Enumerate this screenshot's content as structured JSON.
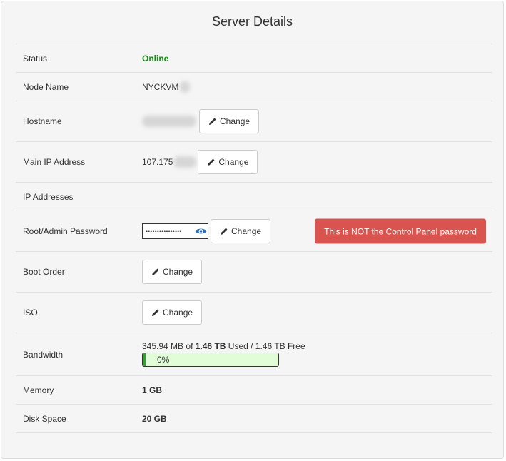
{
  "panel": {
    "title": "Server Details"
  },
  "rows": {
    "status": {
      "label": "Status",
      "value": "Online"
    },
    "node": {
      "label": "Node Name",
      "value": "NYCKVM"
    },
    "hostname": {
      "label": "Hostname",
      "button": "Change"
    },
    "main_ip": {
      "label": "Main IP Address",
      "value": "107.175",
      "button": "Change"
    },
    "ip_addresses": {
      "label": "IP Addresses"
    },
    "password": {
      "label": "Root/Admin Password",
      "masked": "••••••••••••••••",
      "button": "Change",
      "alert": "This is NOT the Control Panel password"
    },
    "boot_order": {
      "label": "Boot Order",
      "button": "Change"
    },
    "iso": {
      "label": "ISO",
      "button": "Change"
    },
    "bandwidth": {
      "label": "Bandwidth",
      "used": "345.94 MB",
      "of": "of",
      "total": "1.46 TB",
      "suffix": "Used / 1.46 TB Free",
      "percent_label": "0%",
      "percent": 0.02
    },
    "memory": {
      "label": "Memory",
      "value": "1 GB"
    },
    "disk": {
      "label": "Disk Space",
      "value": "20 GB"
    }
  },
  "colors": {
    "online": "#1a8a1a",
    "alert_bg": "#d9534f",
    "bar_bg": "#e0fdd8",
    "bar_fill": "#3c9b3c",
    "eye": "#2a6bb5"
  },
  "icons": {
    "edit": "pencil-icon",
    "reveal": "eye-icon"
  }
}
